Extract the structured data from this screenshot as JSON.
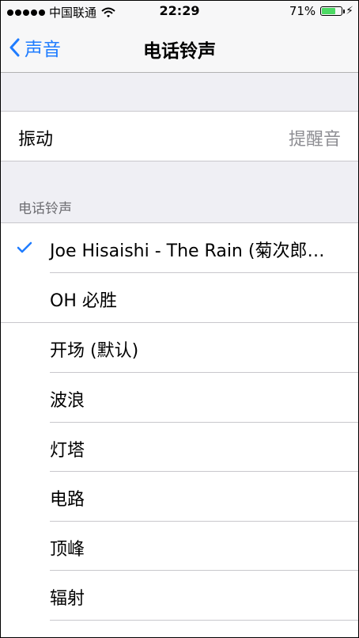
{
  "status_bar": {
    "carrier": "中国联通",
    "time": "22:29",
    "battery_percent": "71%",
    "battery_level": 0.71
  },
  "nav": {
    "back_label": "声音",
    "title": "电话铃声"
  },
  "vibration": {
    "label": "振动",
    "value": "提醒音"
  },
  "section_header": "电话铃声",
  "custom_ringtones": [
    {
      "label": "Joe Hisaishi - The Rain (菊次郎…",
      "selected": true
    },
    {
      "label": "OH 必胜",
      "selected": false
    }
  ],
  "ringtones": [
    {
      "label": "开场 (默认)"
    },
    {
      "label": "波浪"
    },
    {
      "label": "灯塔"
    },
    {
      "label": "电路"
    },
    {
      "label": "顶峰"
    },
    {
      "label": "辐射"
    }
  ],
  "colors": {
    "accent": "#1f7cff",
    "battery": "#4cd964",
    "background": "#efeff4"
  }
}
